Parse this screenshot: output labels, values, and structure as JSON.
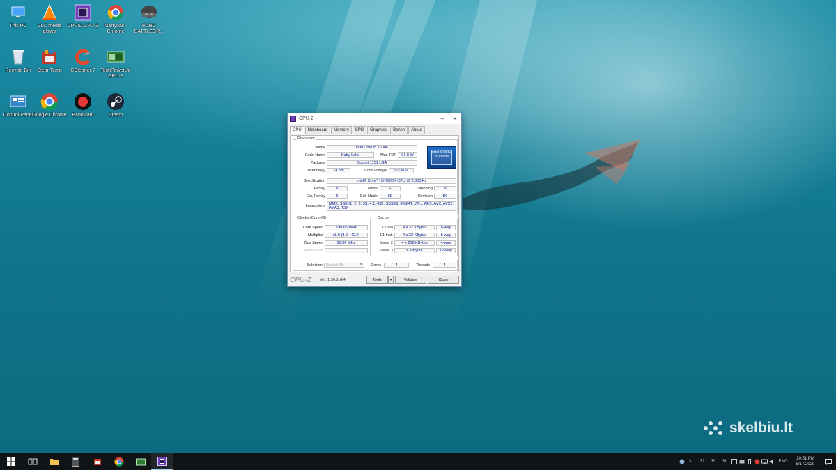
{
  "desktop": {
    "icons": [
      {
        "label": "This PC",
        "icon": "this-pc-icon"
      },
      {
        "label": "VLC media player",
        "icon": "vlc-icon"
      },
      {
        "label": "CPUID CPU-Z",
        "icon": "cpuz-icon"
      },
      {
        "label": "Martynas - Chrome",
        "icon": "chrome-profile-icon"
      },
      {
        "label": "PUBG BATTLEGR...",
        "icon": "pubg-icon"
      },
      {
        "label": "Recycle Bin",
        "icon": "recycle-bin-icon"
      },
      {
        "label": "Clear Temp",
        "icon": "clear-temp-icon"
      },
      {
        "label": "CCleaner 7",
        "icon": "ccleaner-icon"
      },
      {
        "label": "TechPowerUp GPU-Z",
        "icon": "gpuz-icon"
      },
      {
        "label": "Control Panel",
        "icon": "control-panel-icon"
      },
      {
        "label": "Google Chrome",
        "icon": "chrome-icon"
      },
      {
        "label": "Bandicam",
        "icon": "bandicam-icon"
      },
      {
        "label": "Steam",
        "icon": "steam-icon"
      }
    ]
  },
  "cpuz": {
    "title": "CPU-Z",
    "tabs": [
      "CPU",
      "Mainboard",
      "Memory",
      "SPD",
      "Graphics",
      "Bench",
      "About"
    ],
    "processor": {
      "group_title": "Processor",
      "name_label": "Name",
      "name": "Intel Core i5 7600K",
      "codename_label": "Code Name",
      "codename": "Kaby Lake",
      "maxtdp_label": "Max TDP",
      "maxtdp": "91.0 W",
      "package_label": "Package",
      "package": "Socket 1151 LGA",
      "technology_label": "Technology",
      "technology": "14 nm",
      "corevoltage_label": "Core Voltage",
      "corevoltage": "0.736 V",
      "spec_label": "Specification",
      "spec": "Intel® Core™ i5-7600K CPU @ 3.80GHz",
      "family_label": "Family",
      "family": "6",
      "model_label": "Model",
      "model": "E",
      "stepping_label": "Stepping",
      "stepping": "9",
      "extfamily_label": "Ext. Family",
      "extfamily": "6",
      "extmodel_label": "Ext. Model",
      "extmodel": "9E",
      "revision_label": "Revision",
      "revision": "B0",
      "instructions_label": "Instructions",
      "instructions": "MMX, SSE (1, 2, 3, 3S, 4.1, 4.2), SSSE3, EM64T, VT-x, AES, AVX, AVX2, FMA3, TSX",
      "logo_text": "intel CORE i5 inside"
    },
    "clocks": {
      "group_title": "Clocks (Core #0)",
      "corespeed_label": "Core Speed",
      "corespeed": "798.65 MHz",
      "multiplier_label": "Multiplier",
      "multiplier": "x8.0 (8.0 - 42.0)",
      "busspeed_label": "Bus Speed",
      "busspeed": "99.86 MHz",
      "ratedfsb_label": "Rated FSB",
      "ratedfsb": ""
    },
    "cache": {
      "group_title": "Cache",
      "l1data_label": "L1 Data",
      "l1data": "4 x 32 KBytes",
      "l1data_way": "8-way",
      "l1inst_label": "L1 Inst.",
      "l1inst": "4 x 32 KBytes",
      "l1inst_way": "8-way",
      "l2_label": "Level 2",
      "l2": "4 x 256 KBytes",
      "l2_way": "4-way",
      "l3_label": "Level 3",
      "l3": "6 MBytes",
      "l3_way": "12-way"
    },
    "selection": {
      "selection_label": "Selection",
      "selection": "Socket #1",
      "cores_label": "Cores",
      "cores": "4",
      "threads_label": "Threads",
      "threads": "4"
    },
    "footer": {
      "brand": "CPU-Z",
      "version": "Ver. 1.36.3.x64",
      "tools_label": "Tools",
      "validate_label": "Validate",
      "close_label": "Close"
    }
  },
  "watermark": {
    "text": "skelbiu.lt"
  },
  "taskbar": {
    "tray_numbers": [
      "31",
      "32",
      "30",
      "31"
    ],
    "language": "ENG",
    "time": "10:51 PM",
    "date": "8/17/2020"
  },
  "colors": {
    "accent": "#1c8ea6",
    "taskbar": "#101417",
    "value_text": "#001a8c"
  }
}
